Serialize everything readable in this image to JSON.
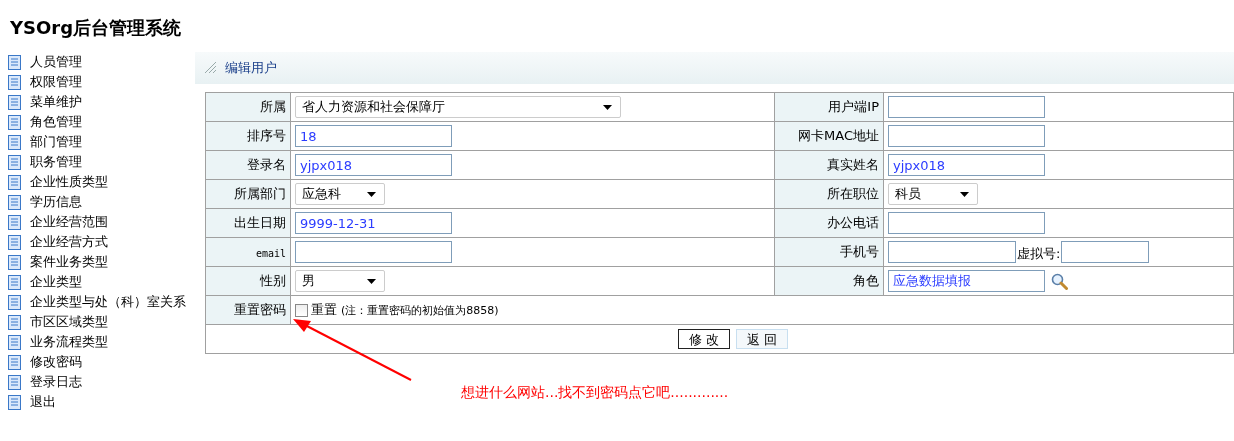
{
  "app_title": "YSOrg后台管理系统",
  "sidebar": {
    "items": [
      {
        "label": "人员管理"
      },
      {
        "label": "权限管理"
      },
      {
        "label": "菜单维护"
      },
      {
        "label": "角色管理"
      },
      {
        "label": "部门管理"
      },
      {
        "label": "职务管理"
      },
      {
        "label": "企业性质类型"
      },
      {
        "label": "学历信息"
      },
      {
        "label": "企业经营范围"
      },
      {
        "label": "企业经营方式"
      },
      {
        "label": "案件业务类型"
      },
      {
        "label": "企业类型"
      },
      {
        "label": "企业类型与处（科）室关系"
      },
      {
        "label": "市区区域类型"
      },
      {
        "label": "业务流程类型"
      },
      {
        "label": "修改密码"
      },
      {
        "label": "登录日志"
      },
      {
        "label": "退出"
      }
    ]
  },
  "panel": {
    "title": "编辑用户"
  },
  "form": {
    "rows": [
      {
        "left": {
          "label": "所属",
          "kind": "wide-select",
          "value": "省人力资源和社会保障厅"
        },
        "right": {
          "label": "用户端IP",
          "kind": "input"
        }
      },
      {
        "left": {
          "label": "排序号",
          "kind": "input",
          "value": "18"
        },
        "right": {
          "label": "网卡MAC地址",
          "kind": "input"
        }
      },
      {
        "left": {
          "label": "登录名",
          "kind": "input",
          "value": "yjpx018"
        },
        "right": {
          "label": "真实姓名",
          "kind": "input",
          "value": "yjpx018"
        }
      },
      {
        "left": {
          "label": "所属部门",
          "kind": "select",
          "value": "应急科"
        },
        "right": {
          "label": "所在职位",
          "kind": "select",
          "value": "科员"
        }
      },
      {
        "left": {
          "label": "出生日期",
          "kind": "input",
          "value": "9999-12-31"
        },
        "right": {
          "label": "办公电话",
          "kind": "input"
        }
      },
      {
        "left": {
          "label": "email",
          "kind": "input"
        },
        "right": {
          "label": "手机号",
          "kind": "input-pair",
          "second_label": "虚拟号:"
        }
      },
      {
        "left": {
          "label": "性别",
          "kind": "select",
          "value": "男"
        },
        "right": {
          "label": "角色",
          "kind": "input-search",
          "value": "应急数据填报"
        }
      }
    ],
    "reset": {
      "label": "重置密码",
      "checked": false,
      "option": "重置",
      "note": "(注：重置密码的初始值为8858)"
    },
    "buttons": [
      "修 改",
      "返 回"
    ]
  },
  "annotation": {
    "text": "想进什么网站...找不到密码点它吧............."
  }
}
